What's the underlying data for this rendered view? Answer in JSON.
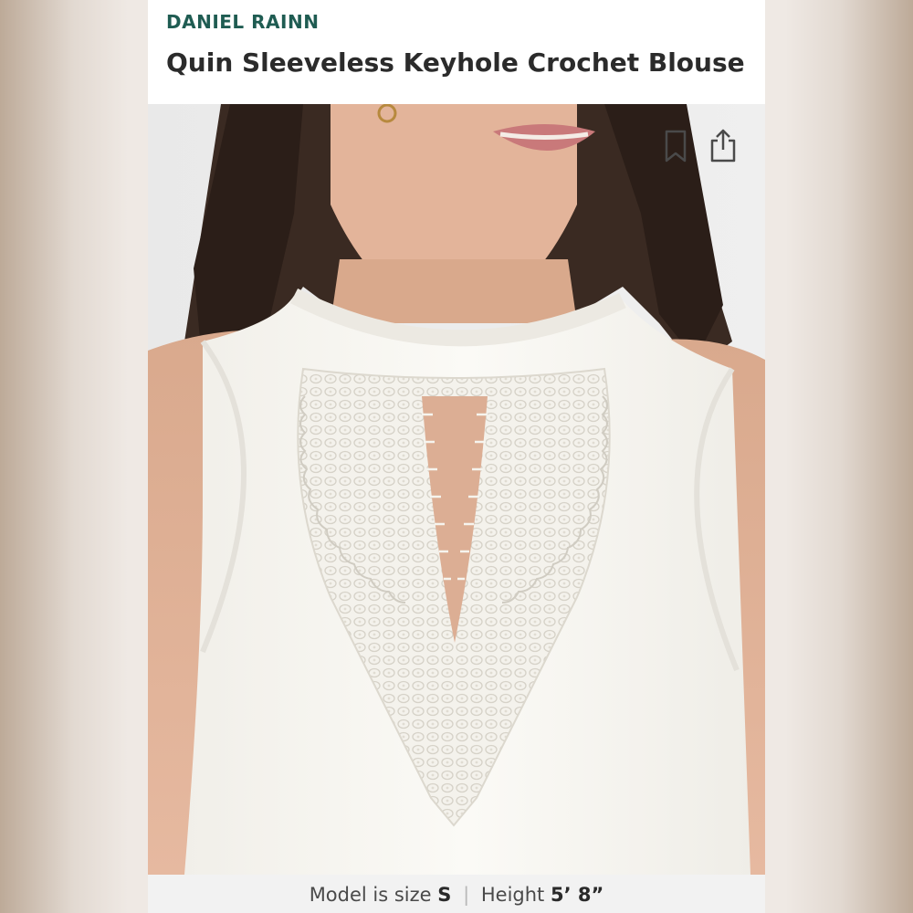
{
  "product": {
    "brand": "DANIEL RAINN",
    "title": "Quin Sleeveless Keyhole Crochet Blouse"
  },
  "image": {
    "alt": "Model wearing ivory sleeveless blouse with crochet keyhole neckline"
  },
  "actions": {
    "bookmark_icon": "bookmark-icon",
    "share_icon": "share-icon"
  },
  "model_info": {
    "size_prefix": "Model is size",
    "size_value": "S",
    "separator": "|",
    "height_prefix": "Height",
    "height_value": "5’ 8”"
  },
  "colors": {
    "brand_accent": "#1f5c52",
    "title_text": "#2b2b2b",
    "footer_bg": "#f2f2f2"
  }
}
